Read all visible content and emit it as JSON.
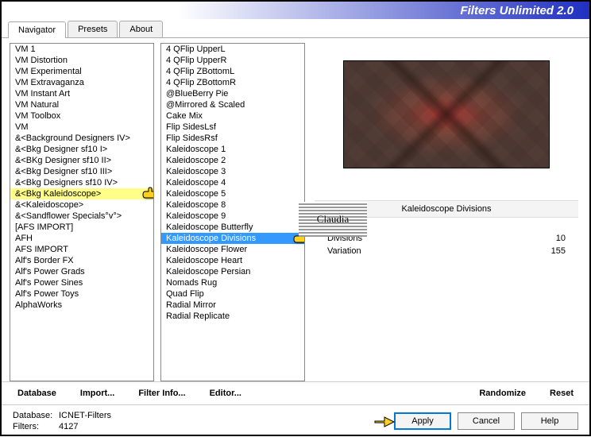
{
  "window": {
    "title": "Filters Unlimited 2.0"
  },
  "tabs": {
    "items": [
      "Navigator",
      "Presets",
      "About"
    ],
    "active": 0
  },
  "list1": {
    "items": [
      "VM 1",
      "VM Distortion",
      "VM Experimental",
      "VM Extravaganza",
      "VM Instant Art",
      "VM Natural",
      "VM Toolbox",
      "VM",
      "&<Background Designers IV>",
      "&<Bkg Designer sf10 I>",
      "&<BKg Designer sf10 II>",
      "&<Bkg Designer sf10 III>",
      "&<Bkg Designers sf10 IV>",
      "&<Bkg Kaleidoscope>",
      "&<Kaleidoscope>",
      "&<Sandflower Specials°v°>",
      "[AFS IMPORT]",
      "AFH",
      "AFS IMPORT",
      "Alf's Border FX",
      "Alf's Power Grads",
      "Alf's Power Sines",
      "Alf's Power Toys",
      "AlphaWorks"
    ],
    "selected": 13
  },
  "list2": {
    "items": [
      "4 QFlip UpperL",
      "4 QFlip UpperR",
      "4 QFlip ZBottomL",
      "4 QFlip ZBottomR",
      "@BlueBerry Pie",
      "@Mirrored & Scaled",
      "Cake Mix",
      "Flip SidesLsf",
      "Flip SidesRsf",
      "Kaleidoscope 1",
      "Kaleidoscope 2",
      "Kaleidoscope 3",
      "Kaleidoscope 4",
      "Kaleidoscope 5",
      "Kaleidoscope 8",
      "Kaleidoscope 9",
      "Kaleidoscope Butterfly",
      "Kaleidoscope Divisions",
      "Kaleidoscope Flower",
      "Kaleidoscope Heart",
      "Kaleidoscope Persian",
      "Nomads Rug",
      "Quad Flip",
      "Radial Mirror",
      "Radial Replicate"
    ],
    "selected": 17
  },
  "params": {
    "title": "Kaleidoscope Divisions",
    "rows": [
      {
        "label": "Divisions",
        "value": "10"
      },
      {
        "label": "Variation",
        "value": "155"
      }
    ]
  },
  "midbar": {
    "database": "Database",
    "import": "Import...",
    "filter_info": "Filter Info...",
    "editor": "Editor...",
    "randomize": "Randomize",
    "reset": "Reset"
  },
  "bottom": {
    "db_label": "Database:",
    "db_value": "ICNET-Filters",
    "filters_label": "Filters:",
    "filters_value": "4127",
    "apply": "Apply",
    "cancel": "Cancel",
    "help": "Help"
  },
  "watermark": "Claudia"
}
